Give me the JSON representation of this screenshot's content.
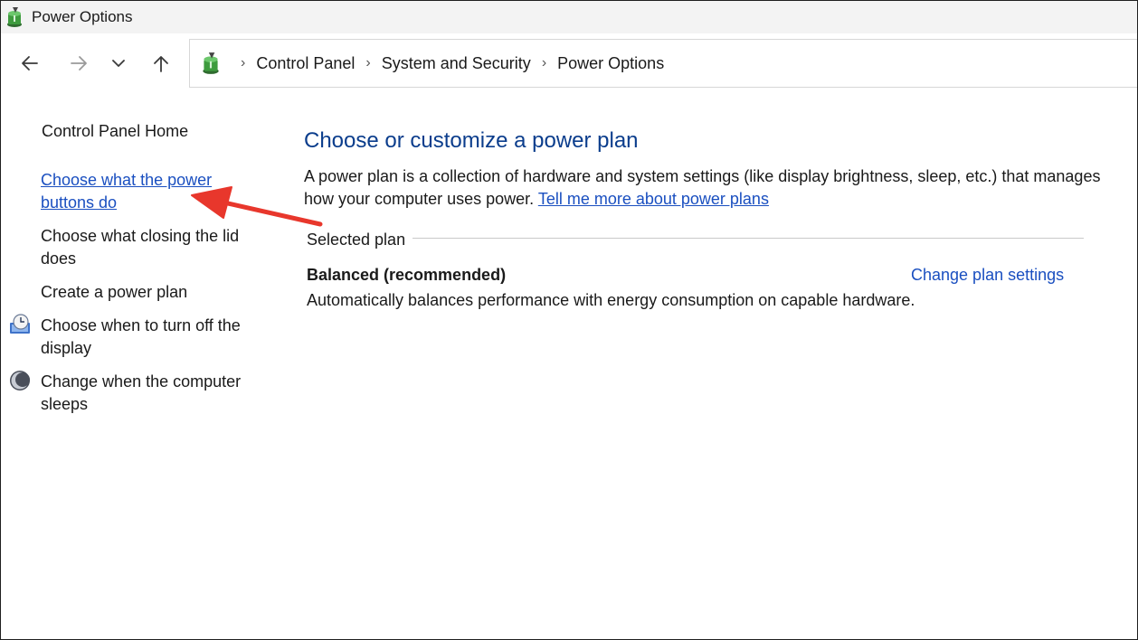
{
  "window": {
    "title": "Power Options",
    "icon": "power-options-icon"
  },
  "toolbar": {
    "back_icon": "arrow-left-icon",
    "forward_icon": "arrow-right-icon",
    "recent_icon": "chevron-down-icon",
    "up_icon": "arrow-up-icon"
  },
  "breadcrumb": {
    "items": [
      "Control Panel",
      "System and Security",
      "Power Options"
    ],
    "separator": "›"
  },
  "sidebar": {
    "home": "Control Panel Home",
    "items": [
      {
        "line1": "Choose what the power",
        "line2": "buttons do",
        "icon": ""
      },
      {
        "line1": "Choose what closing the lid",
        "line2": "does",
        "icon": ""
      },
      {
        "line1": "Create a power plan",
        "line2": "",
        "icon": ""
      },
      {
        "line1": "Choose when to turn off the",
        "line2": "display",
        "icon": "display-clock-icon"
      },
      {
        "line1": "Change when the computer",
        "line2": "sleeps",
        "icon": "moon-icon"
      }
    ]
  },
  "main": {
    "title": "Choose or customize a power plan",
    "desc_line1": "A power plan is a collection of hardware and system settings (like display brightness, sleep, etc.) that manages",
    "desc_line2": "how your computer uses power. ",
    "desc_link": "Tell me more about power plans",
    "section_label": "Selected plan",
    "plan": {
      "name": "Balanced (recommended)",
      "change_link": "Change plan settings",
      "description": "Automatically balances performance with energy consumption on capable hardware."
    }
  },
  "colors": {
    "link": "#1a4fc0",
    "title": "#0b3d8c",
    "annotation_arrow": "#e8372c"
  }
}
